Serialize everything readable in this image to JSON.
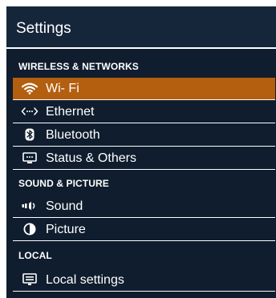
{
  "header": {
    "title": "Settings"
  },
  "sections": [
    {
      "label": "WIRELESS & NETWORKS",
      "items": [
        {
          "label": "Wi- Fi",
          "icon": "wifi-icon",
          "selected": true
        },
        {
          "label": "Ethernet",
          "icon": "ethernet-icon",
          "selected": false
        },
        {
          "label": "Bluetooth",
          "icon": "bluetooth-icon",
          "selected": false
        },
        {
          "label": "Status & Others",
          "icon": "status-icon",
          "selected": false
        }
      ]
    },
    {
      "label": "SOUND & PICTURE",
      "items": [
        {
          "label": "Sound",
          "icon": "speaker-icon",
          "selected": false
        },
        {
          "label": "Picture",
          "icon": "picture-icon",
          "selected": false
        }
      ]
    },
    {
      "label": "LOCAL",
      "items": [
        {
          "label": "Local settings",
          "icon": "local-settings-icon",
          "selected": false
        }
      ]
    }
  ],
  "colors": {
    "panel_background": "#0f1d2e",
    "header_background": "#15263b",
    "selected_row": "#b35f0f",
    "text": "#ffffff"
  }
}
